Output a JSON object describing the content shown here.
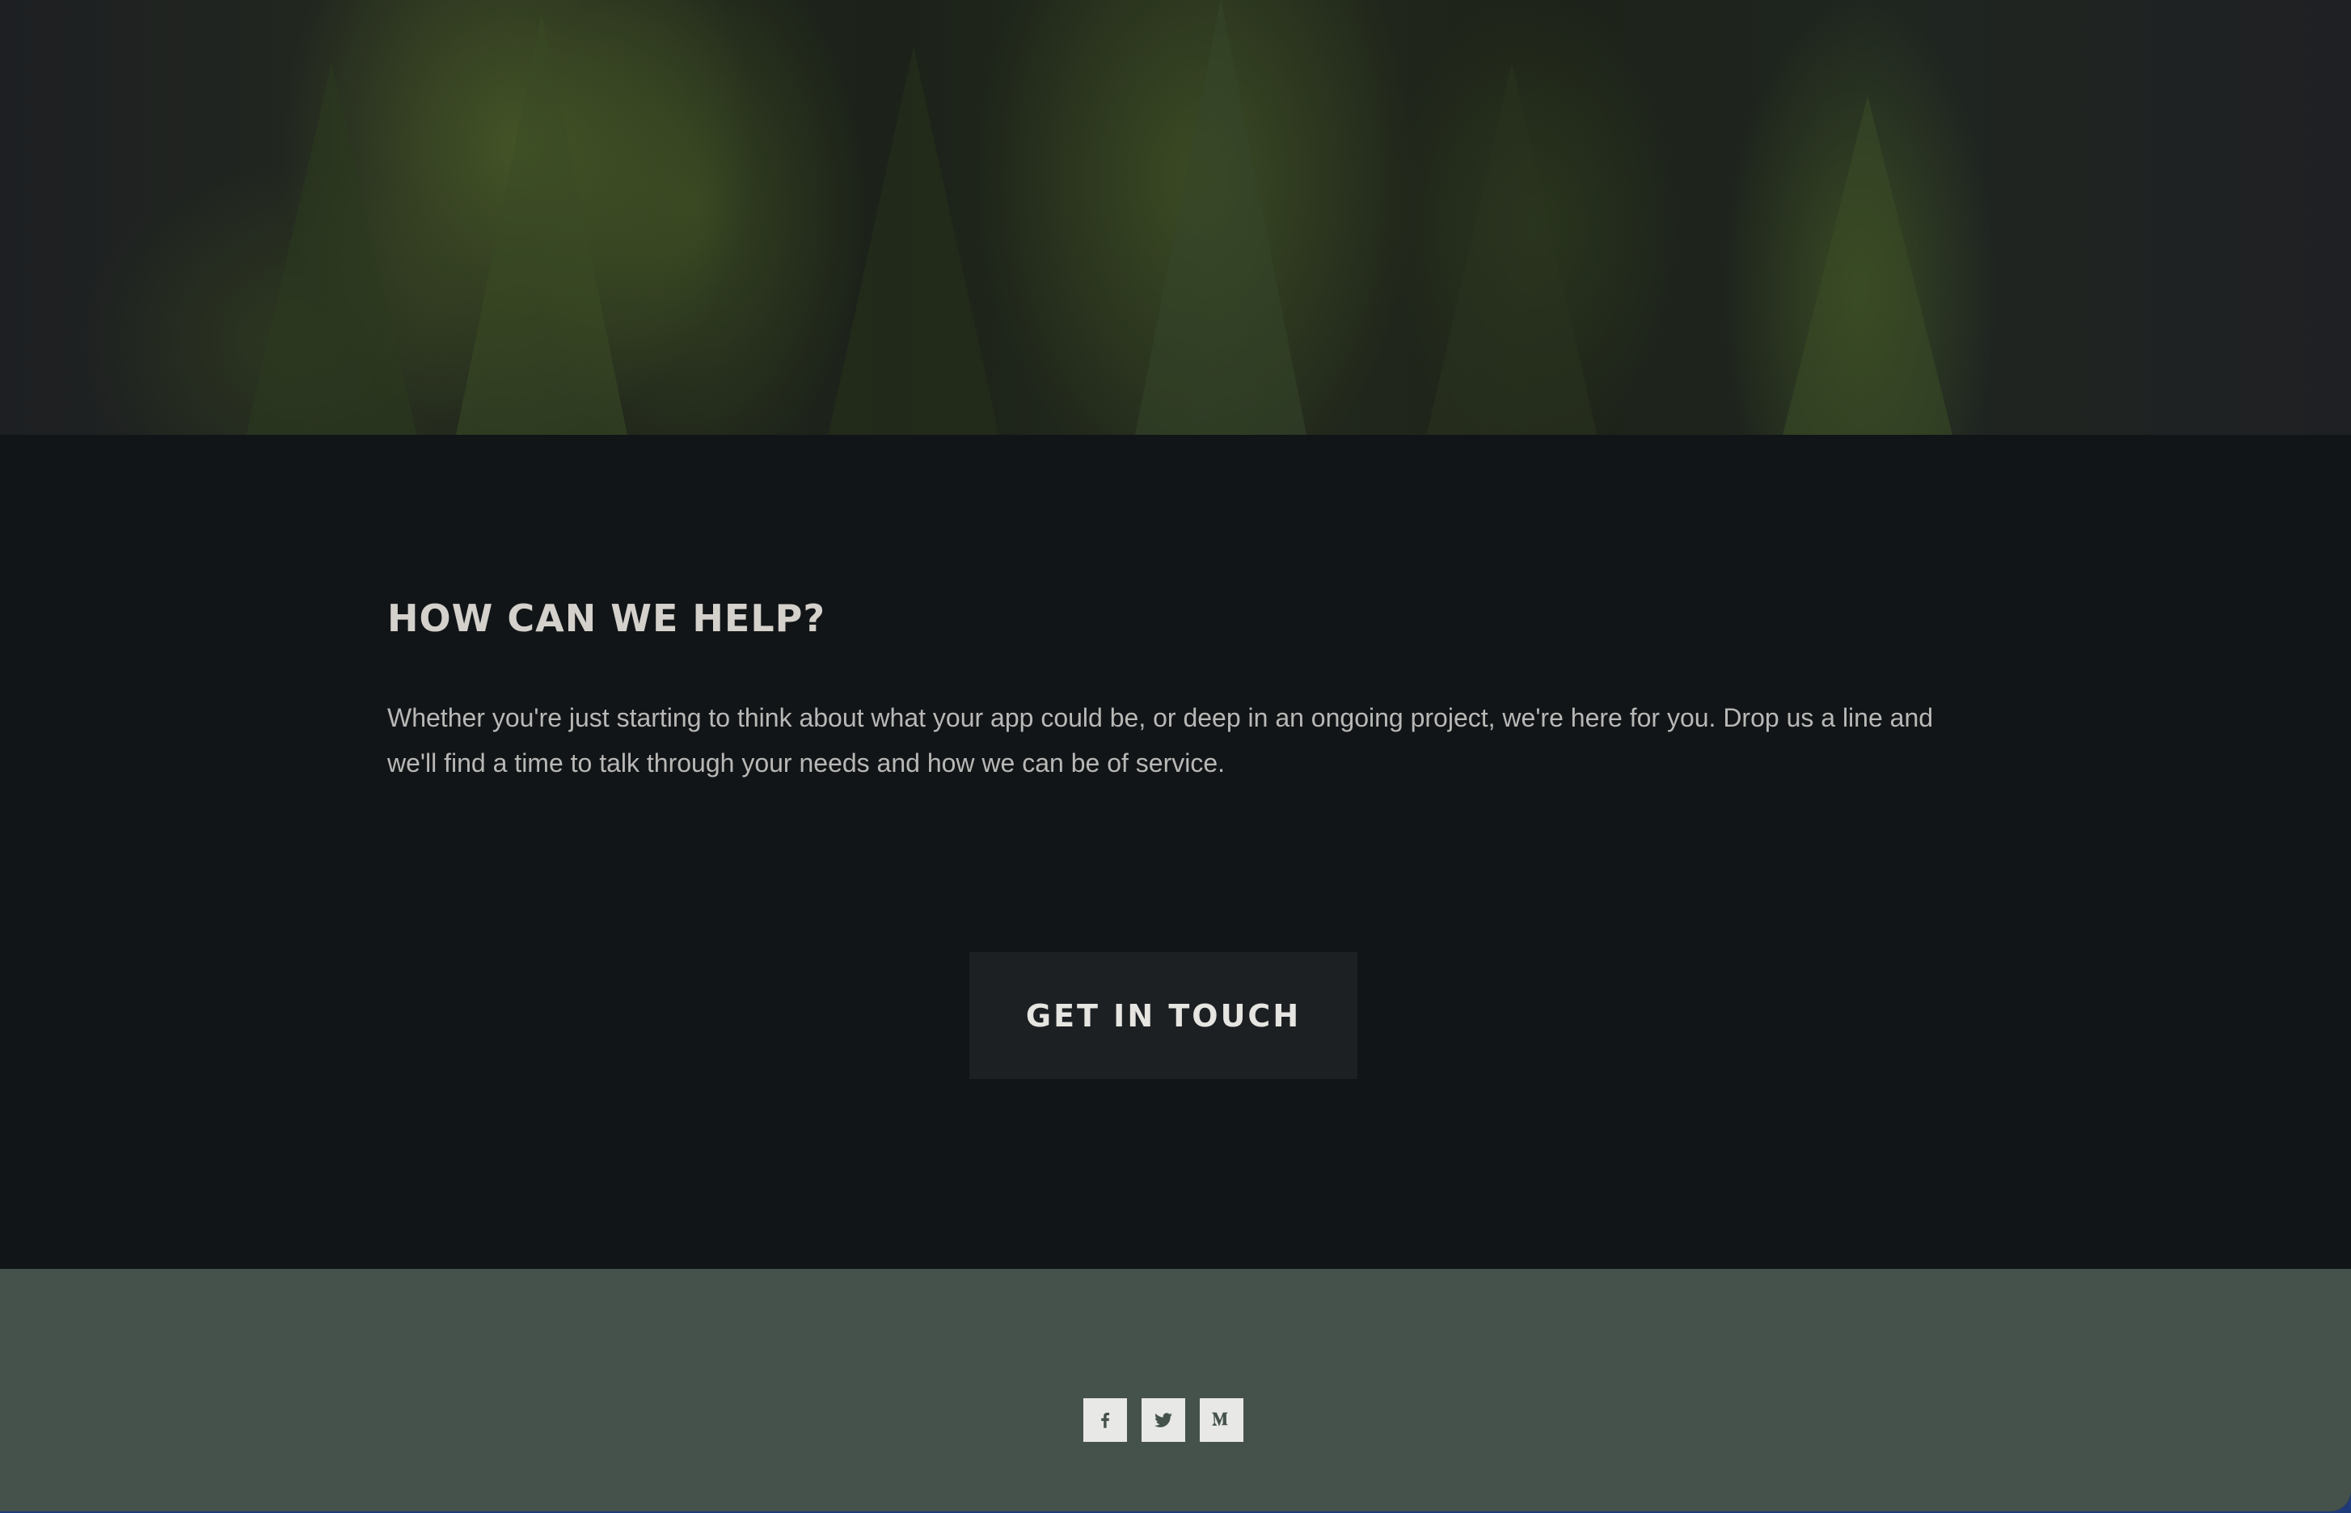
{
  "hero": {
    "description_icon": "forest-image"
  },
  "help_section": {
    "heading": "HOW CAN WE HELP?",
    "body": "Whether you're just starting to think about what your app could be, or deep in an ongoing project, we're here for you. Drop us a line and we'll find a time to talk through your needs and how we can be of service.",
    "cta_label": "GET IN TOUCH"
  },
  "footer": {
    "social": [
      {
        "icon": "facebook-icon"
      },
      {
        "icon": "twitter-icon"
      },
      {
        "icon": "medium-icon"
      }
    ]
  },
  "colors": {
    "content_bg": "#121517",
    "footer_bg": "#45524b",
    "cta_bg": "#1c2023",
    "heading": "#d4d1cc",
    "body_text": "#b8b8b6"
  }
}
